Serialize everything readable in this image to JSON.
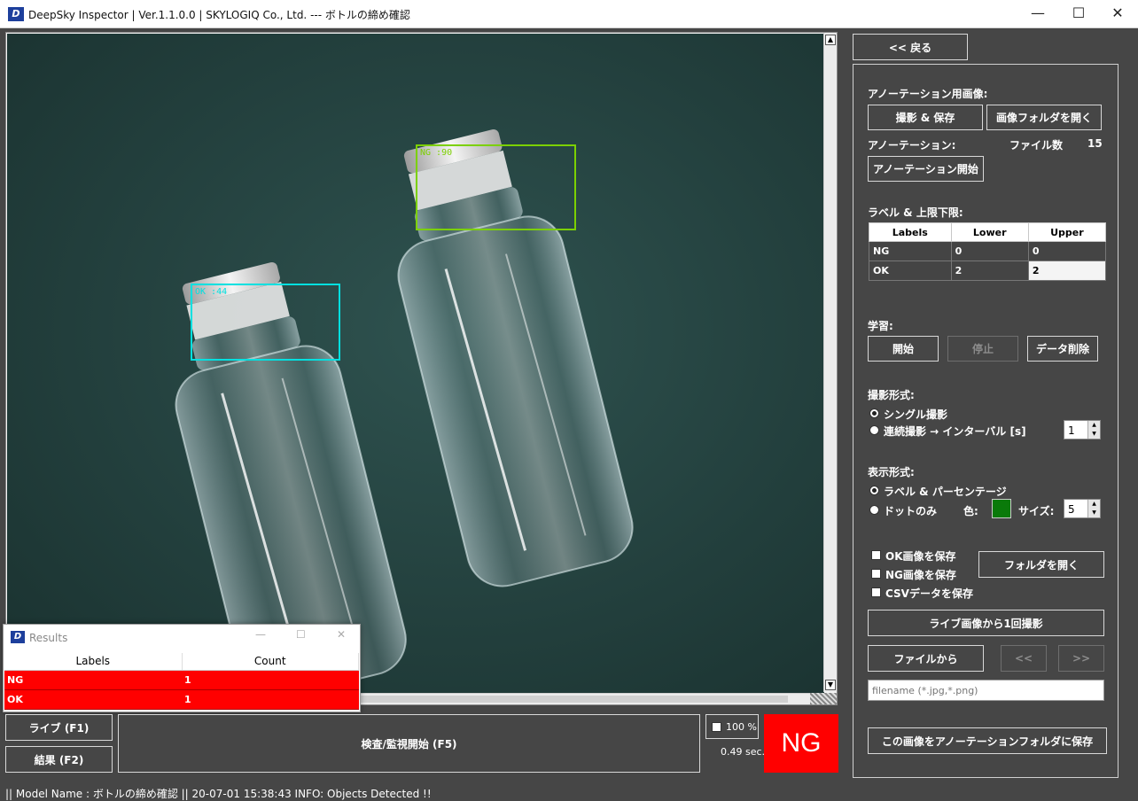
{
  "window": {
    "title": "DeepSky Inspector | Ver.1.1.0.0 | SKYLOGIQ Co., Ltd. --- ボトルの締め確認",
    "min_glyph": "—",
    "max_glyph": "☐",
    "close_glyph": "✕"
  },
  "image": {
    "detections": [
      {
        "label": "OK :44",
        "color": "#00e0e0"
      },
      {
        "label": "NG :90",
        "color": "#7cd000"
      }
    ]
  },
  "scroll": {
    "up": "▲",
    "down": "▼"
  },
  "controls": {
    "back": "<< 戻る",
    "live": "ライブ (F1)",
    "results": "結果 (F2)",
    "inspect": "検査/監視開始 (F5)",
    "zoom": "100 %",
    "elapsed": "0.49 sec.",
    "verdict": "NG"
  },
  "status": {
    "text": "|| Model Name : ボトルの締め確認 ||   20-07-01 15:38:43   INFO:   Objects Detected !!"
  },
  "panel": {
    "annotation_images_label": "アノーテーション用画像:",
    "capture_save": "撮影 & 保存",
    "open_image_folder": "画像フォルダを開く",
    "annotation_label": "アノーテーション:",
    "file_count_label": "ファイル数",
    "file_count": "15",
    "start_annotation": "アノーテーション開始",
    "limits_label": "ラベル & 上限下限:",
    "table_headers": [
      "Labels",
      "Lower",
      "Upper"
    ],
    "table_rows": [
      {
        "label": "NG",
        "lower": "0",
        "upper": "0"
      },
      {
        "label": "OK",
        "lower": "2",
        "upper": "2"
      }
    ],
    "learning_label": "学習:",
    "learn_start": "開始",
    "learn_stop": "停止",
    "delete_data": "データ削除",
    "capture_mode_label": "撮影形式:",
    "single_capture": "シングル撮影",
    "continuous_capture": "連続撮影 → インターバル [s]",
    "interval": "1",
    "display_mode_label": "表示形式:",
    "label_percentage": "ラベル & パーセンテージ",
    "dots_only": "ドットのみ",
    "color_label": "色:",
    "dot_color": "#0a7a0a",
    "size_label": "サイズ:",
    "size": "5",
    "save_ok": "OK画像を保存",
    "save_ng": "NG画像を保存",
    "save_csv": "CSVデータを保存",
    "open_folder": "フォルダを開く",
    "capture_from_live": "ライブ画像から1回撮影",
    "from_file": "ファイルから",
    "prev": "<<",
    "next": ">>",
    "filename_placeholder": "filename (*.jpg,*.png)",
    "save_to_annotation": "この画像をアノーテーションフォルダに保存"
  },
  "results_window": {
    "title": "Results",
    "headers": [
      "Labels",
      "Count"
    ],
    "rows": [
      {
        "label": "NG",
        "count": "1"
      },
      {
        "label": "OK",
        "count": "1"
      }
    ]
  }
}
